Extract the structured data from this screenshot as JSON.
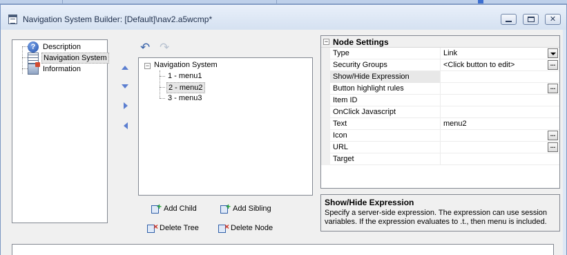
{
  "window": {
    "title": "Navigation System Builder: [Default]\\nav2.a5wcmp*"
  },
  "left_nav": {
    "items": [
      {
        "label": "Description",
        "icon": "help-icon"
      },
      {
        "label": "Navigation System",
        "icon": "grid-icon",
        "selected": true
      },
      {
        "label": "Information",
        "icon": "info-icon"
      }
    ]
  },
  "toolbar": {
    "undo_icon": "undo-icon",
    "redo_icon": "redo-icon",
    "move_buttons": [
      "move-up-icon",
      "move-down-icon",
      "indent-icon",
      "outdent-icon"
    ]
  },
  "tree": {
    "root": "Navigation System",
    "nodes": [
      {
        "label": "1 - menu1"
      },
      {
        "label": "2 - menu2",
        "selected": true
      },
      {
        "label": "3 - menu3"
      }
    ]
  },
  "actions": {
    "add_child": "Add Child",
    "add_sibling": "Add Sibling",
    "delete_tree": "Delete Tree",
    "delete_node": "Delete Node"
  },
  "node_settings": {
    "header": "Node Settings",
    "rows": [
      {
        "name": "Type",
        "value": "Link"
      },
      {
        "name": "Security Groups",
        "value": "<Click button to edit>"
      },
      {
        "name": "Show/Hide Expression",
        "value": ""
      },
      {
        "name": "Button highlight rules",
        "value": ""
      },
      {
        "name": "Item ID",
        "value": ""
      },
      {
        "name": "OnClick Javascript",
        "value": ""
      },
      {
        "name": "Text",
        "value": "menu2"
      },
      {
        "name": "Icon",
        "value": ""
      },
      {
        "name": "URL",
        "value": ""
      },
      {
        "name": "Target",
        "value": ""
      }
    ],
    "ellipsis_label": "..."
  },
  "help": {
    "title": "Show/Hide Expression",
    "description": "Specify a server-side expression. The expression can use session variables. If the expression evaluates to .t., then menu is included."
  },
  "colors": {
    "titlebar": "#dbe5f3",
    "accent_blue": "#3660a8",
    "panel_bg": "#f0f0f0"
  }
}
